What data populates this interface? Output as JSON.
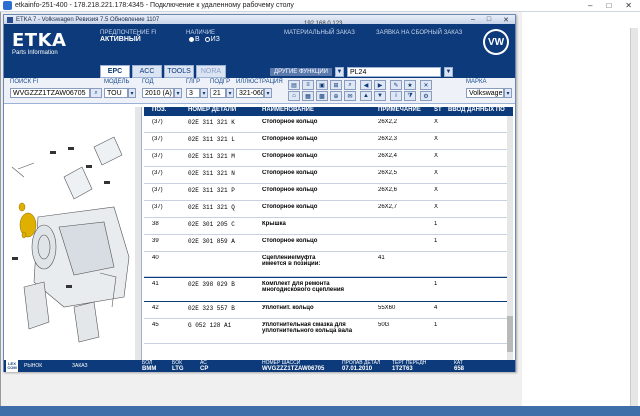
{
  "rdp": {
    "title": "etkainfo-251-400 - 178.218.221.178:4345 - Подключение к удаленному рабочему столу",
    "address": "192.168.0.123"
  },
  "app": {
    "title": "ETKA 7 - Volkswagen Ревизия 7.5 Обновление 1107",
    "logo": "ETKA",
    "logo_sub": "Parts Information",
    "prefix_label": "ПРЕДПОЧТЕНИЕ FI",
    "prefix_value": "АКТИВНЫЙ",
    "stock_label": "НАЛИЧИЕ",
    "stock_b": "B",
    "stock_iz": "ИЗ",
    "material_order": "МАТЕРИАЛЬНЫЙ ЗАКАЗ",
    "assembly_order": "ЗАЯВКА НА СБОРНЫЙ ЗАКАЗ",
    "brand_mark": "VW",
    "tabs": [
      "EPC",
      "ACC",
      "TOOLS",
      "NORA"
    ],
    "func_label": "ДРУГИЕ ФУНКЦИИ",
    "func_value": "PL24"
  },
  "filters": {
    "search_label": "ПОИСК FI",
    "search_value": "WVGZZZ1TZAW06705",
    "model_label": "МОДЕЛЬ",
    "model_value": "TOU",
    "year_label": "ГОД",
    "year_value": "2010 (A)",
    "group_label": "ГЛГР",
    "group_value": "3",
    "sub_label": "ПОДГР",
    "sub_value": "21",
    "illus_label": "ИЛЛЮСТРАЦИЯ",
    "illus_value": "321-060",
    "brand_label": "МАРКА",
    "brand_value": "Volkswagen"
  },
  "table": {
    "headers": [
      "ПОЗ.",
      "НОМЕР ДЕТАЛИ",
      "НАИМЕНОВАНИЕ",
      "ПРИМЕЧАНИЕ",
      "ST",
      "ВВОД ДАННЫХ ПО"
    ],
    "rows": [
      {
        "pos": "(37)",
        "part": "02E 311 321 K",
        "name": "Стопорное кольцо",
        "note": "26X2,2",
        "st": "X",
        "extra": ""
      },
      {
        "pos": "(37)",
        "part": "02E 311 321 L",
        "name": "Стопорное кольцо",
        "note": "26X2,3",
        "st": "X",
        "extra": ""
      },
      {
        "pos": "(37)",
        "part": "02E 311 321 M",
        "name": "Стопорное кольцо",
        "note": "26X2,4",
        "st": "X",
        "extra": ""
      },
      {
        "pos": "(37)",
        "part": "02E 311 321 N",
        "name": "Стопорное кольцо",
        "note": "26X2,5",
        "st": "X",
        "extra": ""
      },
      {
        "pos": "(37)",
        "part": "02E 311 321 P",
        "name": "Стопорное кольцо",
        "note": "26X2,6",
        "st": "X",
        "extra": ""
      },
      {
        "pos": "(37)",
        "part": "02E 311 321 Q",
        "name": "Стопорное кольцо",
        "note": "26X2,7",
        "st": "X",
        "extra": ""
      },
      {
        "pos": "38",
        "part": "02E 301 205 C",
        "name": "Крышка",
        "note": "",
        "st": "1",
        "extra": ""
      },
      {
        "pos": "39",
        "part": "02E 301 859 A",
        "name": "Стопорное кольцо",
        "note": "",
        "st": "1",
        "extra": ""
      },
      {
        "pos": "40",
        "part": "",
        "name": "Сцепление/муфта\n    имеется в позиции:",
        "note": "41",
        "st": "",
        "extra": ""
      },
      {
        "pos": "41",
        "part": "02E 398 029 B",
        "name": "Комплект для ремонта\nмногодискового сцепления",
        "note": "",
        "st": "1",
        "extra": "",
        "selected": true
      },
      {
        "pos": "42",
        "part": "02E 323 557 B",
        "name": "Уплотнит. кольцо",
        "note": "55X60",
        "st": "4",
        "extra": ""
      },
      {
        "pos": "45",
        "part": "G   052 128 A1",
        "name": "Уплотнительная смазка для\nуплотнительного кольца вала",
        "note": "50G",
        "st": "1",
        "extra": ""
      }
    ]
  },
  "footer": {
    "lexcom": "LEX COM",
    "market": "РЫНОК",
    "order": "ЗАКАЗ",
    "bol_label": "БОЛ",
    "bol_value": "BMM",
    "bok_label": "БОК",
    "bok_value": "LTG",
    "ac_label": "АС",
    "ac_value": "CP",
    "chassis_label": "НОМЕР ШАССИ",
    "chassis_value": "WVGZZZ1TZAW06705",
    "date_label": "ПРОЛАВ ДЕТАЛ",
    "date_value": "07.01.2010",
    "gear_label": "ТЕРГ ПЕРЕДН",
    "gear_value": "1T2T63",
    "cat_label": "КАТ",
    "cat_value": "658"
  }
}
